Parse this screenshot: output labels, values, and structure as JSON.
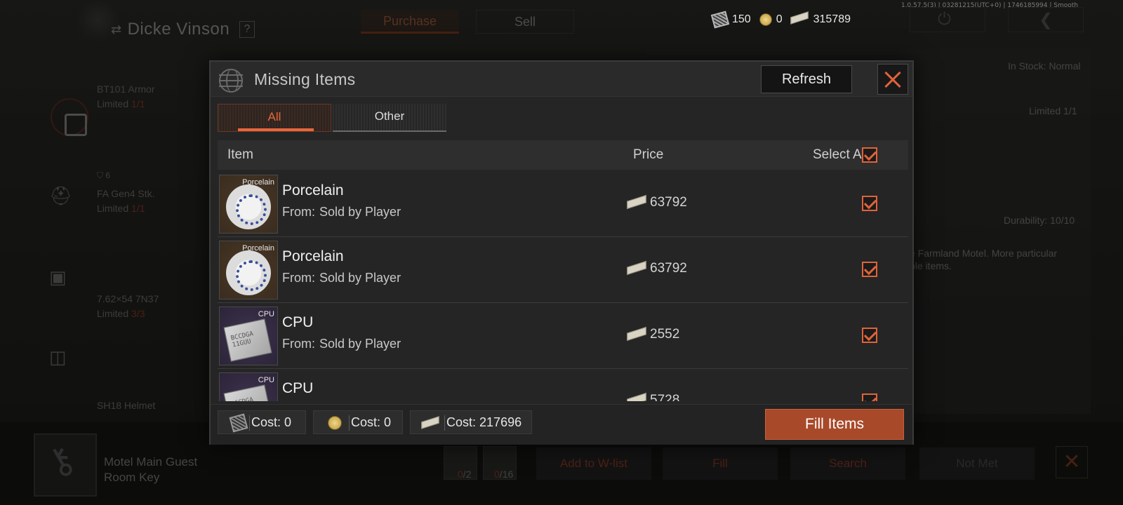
{
  "top_bar": {
    "trader_name": "Dicke Vinson",
    "help": "?",
    "tabs": [
      "Purchase",
      "Sell"
    ],
    "currencies": [
      {
        "icon": "coupon-icon",
        "value": "150"
      },
      {
        "icon": "coin-icon",
        "value": "0"
      },
      {
        "icon": "cash-icon",
        "value": "315789"
      }
    ],
    "version": "1.0.57.5(3) | 03281215(UTC+0) | 1746185994 | Smooth"
  },
  "background": {
    "items": [
      {
        "name": "BT101 Armor",
        "limited_label": "Limited",
        "limit": "1/1"
      },
      {
        "name": "FA Gen4 Stk.",
        "limited_label": "Limited",
        "limit": "1/1"
      },
      {
        "name": "7.62×54 7N37",
        "limited_label": "Limited",
        "limit": "3/3"
      },
      {
        "name": "SH18 Helmet",
        "limited_label": "Limited",
        "limit": "1/1"
      }
    ],
    "armor_badge": "6",
    "in_stock": "In Stock: Normal",
    "limited_right": "Limited 1/1",
    "durability": "Durability: 10/10",
    "desc": "e Farmland Motel. More particular\nble items.",
    "key_name": "Motel Main Guest\nRoom Key",
    "bottom_counts": [
      {
        "have": "0",
        "need": "2"
      },
      {
        "have": "0",
        "need": "16"
      }
    ],
    "bottom_buttons": [
      "Add to W-list",
      "Fill",
      "Search",
      "Not Met"
    ]
  },
  "modal": {
    "title": "Missing Items",
    "refresh_label": "Refresh",
    "tabs": [
      {
        "label": "All",
        "active": true
      },
      {
        "label": "Other",
        "active": false
      }
    ],
    "columns": {
      "item": "Item",
      "price": "Price",
      "select_all": "Select All"
    },
    "select_all_checked": true,
    "from_label": "From:",
    "rows": [
      {
        "tag": "Porcelain",
        "kind": "porcelain",
        "name": "Porcelain",
        "source": "Sold by Player",
        "price": "63792",
        "checked": true
      },
      {
        "tag": "Porcelain",
        "kind": "porcelain",
        "name": "Porcelain",
        "source": "Sold by Player",
        "price": "63792",
        "checked": true
      },
      {
        "tag": "CPU",
        "kind": "cpu",
        "name": "CPU",
        "source": "Sold by Player",
        "price": "2552",
        "checked": true
      },
      {
        "tag": "CPU",
        "kind": "cpu",
        "name": "CPU",
        "source": "",
        "price": "5728",
        "checked": true
      }
    ],
    "costs": [
      {
        "icon": "coupon-icon",
        "label": "Cost:",
        "value": "0"
      },
      {
        "icon": "coin-icon",
        "label": "Cost:",
        "value": "0"
      },
      {
        "icon": "cash-icon",
        "label": "Cost:",
        "value": "217696"
      }
    ],
    "fill_label": "Fill Items"
  },
  "colors": {
    "accent": "#e0633a",
    "fill_button": "#a84a2a"
  }
}
